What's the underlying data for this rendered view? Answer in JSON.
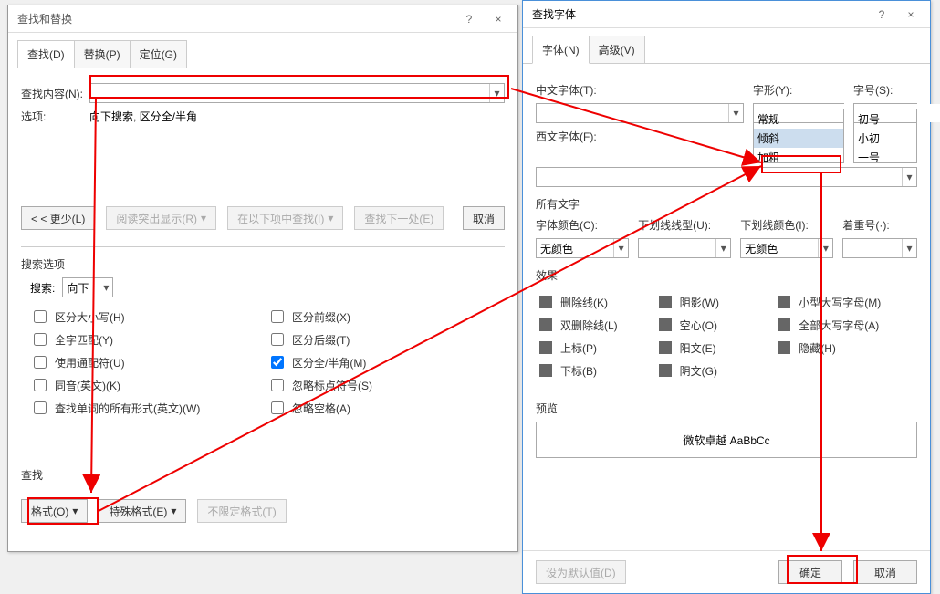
{
  "find_dialog": {
    "title": "查找和替换",
    "help_icon": "?",
    "close_icon": "×",
    "tabs": {
      "find": "查找(D)",
      "replace": "替换(P)",
      "goto": "定位(G)"
    },
    "find_label": "查找内容(N):",
    "find_value": "",
    "options_label": "选项:",
    "options_value": "向下搜索, 区分全/半角",
    "buttons": {
      "less": "< < 更少(L)",
      "reading": "阅读突出显示(R)",
      "findin": "在以下项中查找(I)",
      "findnext": "查找下一处(E)",
      "cancel": "取消"
    },
    "search_options_title": "搜索选项",
    "search_label": "搜索:",
    "search_dir": "向下",
    "checks_left": [
      "区分大小写(H)",
      "全字匹配(Y)",
      "使用通配符(U)",
      "同音(英文)(K)",
      "查找单词的所有形式(英文)(W)"
    ],
    "checks_right": [
      {
        "label": "区分前缀(X)",
        "checked": false
      },
      {
        "label": "区分后缀(T)",
        "checked": false
      },
      {
        "label": "区分全/半角(M)",
        "checked": true
      },
      {
        "label": "忽略标点符号(S)",
        "checked": false
      },
      {
        "label": "忽略空格(A)",
        "checked": false
      }
    ],
    "find_section": "查找",
    "format_btn": "格式(O)",
    "special_btn": "特殊格式(E)",
    "noformat_btn": "不限定格式(T)"
  },
  "font_dialog": {
    "title": "查找字体",
    "tabs": {
      "font": "字体(N)",
      "adv": "高级(V)"
    },
    "cn_font_label": "中文字体(T):",
    "style_label": "字形(Y):",
    "size_label": "字号(S):",
    "en_font_label": "西文字体(F):",
    "style_list": [
      "常规",
      "倾斜",
      "加粗"
    ],
    "style_value": "",
    "size_list": [
      "初号",
      "小初",
      "一号"
    ],
    "all_text_label": "所有文字",
    "font_color_label": "字体颜色(C):",
    "underline_label": "下划线线型(U):",
    "underline_color_label": "下划线颜色(I):",
    "emphasis_label": "着重号(·):",
    "nocolor": "无颜色",
    "effects_label": "效果",
    "effects_left": [
      "删除线(K)",
      "双删除线(L)",
      "上标(P)",
      "下标(B)"
    ],
    "effects_mid": [
      "阴影(W)",
      "空心(O)",
      "阳文(E)",
      "阴文(G)"
    ],
    "effects_right": [
      "小型大写字母(M)",
      "全部大写字母(A)",
      "隐藏(H)"
    ],
    "preview_label": "预览",
    "preview_text": "微软卓越  AaBbCc",
    "default_btn": "设为默认值(D)",
    "ok_btn": "确定",
    "cancel_btn": "取消"
  }
}
